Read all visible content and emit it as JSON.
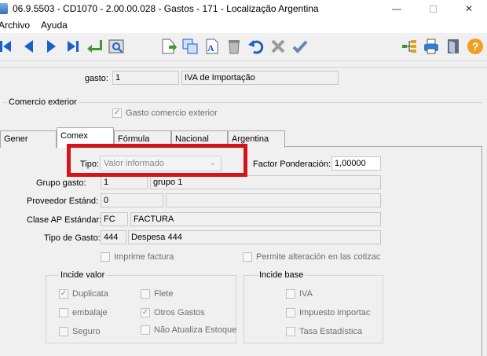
{
  "window": {
    "title": "06.9.5503 - CD1070 - 2.00.00.028 - Gastos - 171 - Localização Argentina",
    "minimize": "—",
    "close": "✕"
  },
  "menu": {
    "items": [
      "Archivo",
      "Ayuda"
    ]
  },
  "toolbar": {
    "icons": [
      "first-icon",
      "previous-icon",
      "next-icon",
      "last-icon",
      "return-icon",
      "search-icon",
      "new-icon",
      "copy-icon",
      "text-edit-icon",
      "delete-icon",
      "undo-icon",
      "cancel-icon",
      "confirm-icon",
      "tree-icon",
      "print-icon",
      "exit-icon",
      "help-icon"
    ],
    "colors": {
      "nav": "#1a5fc8",
      "green": "#3c9a2b",
      "help": "#f0a020"
    }
  },
  "header": {
    "gasto_label": "gasto:",
    "gasto_code": "1",
    "gasto_desc": "IVA de Importação"
  },
  "comercio": {
    "title": "Comercio exterior",
    "checkbox_label": "Gasto comercio exterior",
    "checked": true
  },
  "tabs": {
    "items": [
      "Gener",
      "Comex",
      "Fórmula",
      "Nacional",
      "Argentina"
    ],
    "active": "Comex"
  },
  "form": {
    "tipo_label": "Tipo:",
    "tipo_value": "Valor informado",
    "factor_label": "Factor Ponderación:",
    "factor_value": "1,00000",
    "grupo_label": "Grupo gasto:",
    "grupo_code": "1",
    "grupo_desc": "grupo 1",
    "proveedor_label": "Proveedor Estánd:",
    "proveedor_code": "0",
    "clase_label": "Clase AP Estándar:",
    "clase_code": "FC",
    "clase_desc": "FACTURA",
    "tipo_gasto_label": "Tipo de Gasto:",
    "tipo_gasto_code": "444",
    "tipo_gasto_desc": "Despesa 444",
    "imprime_label": "Imprime factura",
    "permite_label": "Permite alteración en las cotizac"
  },
  "incide_valor": {
    "title": "Incide valor",
    "duplicata": "Duplicata",
    "flete": "Flete",
    "embalaje": "embalaje",
    "otros": "Otros Gastos",
    "seguro": "Seguro",
    "nao_atualiza": "Não Atualiza Estoque"
  },
  "incide_base": {
    "title": "Incide base",
    "iva": "IVA",
    "impuesto": "Impuesto importac",
    "tasa": "Tasa Estadística"
  },
  "check_glyph": "✓",
  "highlight_color": "#d3151a"
}
